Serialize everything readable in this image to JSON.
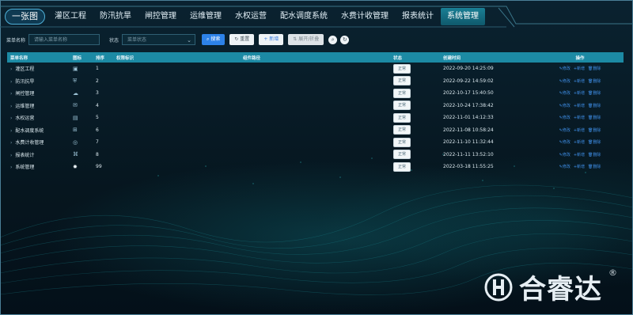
{
  "nav": {
    "home": "一张图",
    "items": [
      {
        "label": "灌区工程"
      },
      {
        "label": "防汛抗旱"
      },
      {
        "label": "闸控管理"
      },
      {
        "label": "运维管理"
      },
      {
        "label": "水权运营"
      },
      {
        "label": "配水调度系统"
      },
      {
        "label": "水费计收管理"
      },
      {
        "label": "报表统计"
      },
      {
        "label": "系统管理"
      }
    ]
  },
  "filters": {
    "menu_name_label": "菜单名称",
    "menu_name_placeholder": "请输入菜单名称",
    "status_label": "状态",
    "status_placeholder": "菜单状态",
    "search_btn": "搜索",
    "reset_btn": "重置",
    "add_btn": "新增",
    "expand_btn": "展开/折叠"
  },
  "table": {
    "headers": {
      "name": "菜单名称",
      "icon": "图标",
      "order": "排序",
      "perm": "权限标识",
      "comp": "组件路径",
      "status": "状态",
      "time": "创建时间",
      "ops": "操作"
    },
    "rows": [
      {
        "name": "灌区工程",
        "icon": "building-icon",
        "order": "1",
        "status": "正常",
        "time": "2022-09-20 14:25:09"
      },
      {
        "name": "防汛抗旱",
        "icon": "shield-icon",
        "order": "2",
        "status": "正常",
        "time": "2022-09-22 14:59:02"
      },
      {
        "name": "闸控管理",
        "icon": "gate-icon",
        "order": "3",
        "status": "正常",
        "time": "2022-10-17 15:40:50"
      },
      {
        "name": "运维管理",
        "icon": "tools-icon",
        "order": "4",
        "status": "正常",
        "time": "2022-10-24 17:38:42"
      },
      {
        "name": "水权运营",
        "icon": "chart-icon",
        "order": "5",
        "status": "正常",
        "time": "2022-11-01 14:12:33"
      },
      {
        "name": "配水调度系统",
        "icon": "dispatch-icon",
        "order": "6",
        "status": "正常",
        "time": "2022-11-08 10:58:24"
      },
      {
        "name": "水费计收管理",
        "icon": "fee-icon",
        "order": "7",
        "status": "正常",
        "time": "2022-11-10 11:32:44"
      },
      {
        "name": "报表统计",
        "icon": "report-icon",
        "order": "8",
        "status": "正常",
        "time": "2022-11-11 13:52:10"
      },
      {
        "name": "系统管理",
        "icon": "gear-icon",
        "order": "99",
        "status": "正常",
        "time": "2022-03-18 11:55:25"
      }
    ],
    "ops": {
      "edit": "修改",
      "add": "新增",
      "delete": "删除"
    }
  },
  "logo": {
    "text": "合睿达",
    "reg": "®"
  },
  "colors": {
    "accent": "#1c8aa4",
    "primary_button": "#2d82e8",
    "link": "#3f8fe8"
  }
}
